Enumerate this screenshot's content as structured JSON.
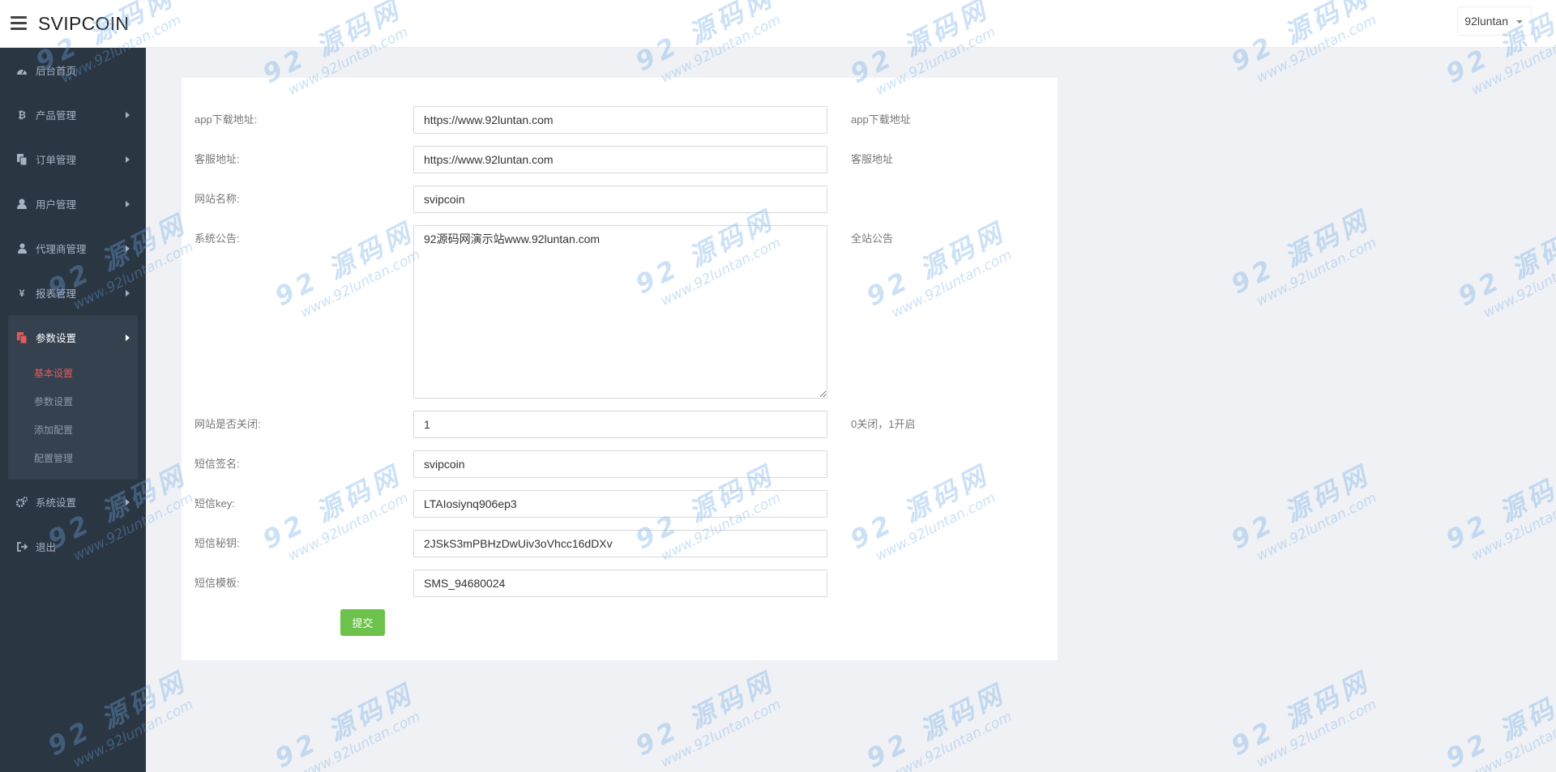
{
  "header": {
    "brand": "SVIPCOIN",
    "user_name": "92luntan"
  },
  "sidebar": {
    "items": [
      {
        "label": "后台首页",
        "icon": "dashboard-icon",
        "has_arrow": false
      },
      {
        "label": "产品管理",
        "icon": "bitcoin-icon",
        "has_arrow": true
      },
      {
        "label": "订单管理",
        "icon": "copy-icon",
        "has_arrow": true
      },
      {
        "label": "用户管理",
        "icon": "user-icon",
        "has_arrow": true
      },
      {
        "label": "代理商管理",
        "icon": "users-icon",
        "has_arrow": true
      },
      {
        "label": "报表管理",
        "icon": "yen-icon",
        "has_arrow": true
      },
      {
        "label": "参数设置",
        "icon": "files-icon",
        "has_arrow": true
      },
      {
        "label": "系统设置",
        "icon": "cogs-icon",
        "has_arrow": true
      },
      {
        "label": "退出",
        "icon": "sign-out-icon",
        "has_arrow": false
      }
    ],
    "sub_items": [
      {
        "label": "基本设置",
        "active": true
      },
      {
        "label": "参数设置",
        "active": false
      },
      {
        "label": "添加配置",
        "active": false
      },
      {
        "label": "配置管理",
        "active": false
      }
    ]
  },
  "form": {
    "fields": [
      {
        "label": "app下载地址:",
        "value": "https://www.92luntan.com",
        "help": "app下载地址"
      },
      {
        "label": "客服地址:",
        "value": "https://www.92luntan.com",
        "help": "客服地址"
      },
      {
        "label": "网站名称:",
        "value": "svipcoin",
        "help": ""
      },
      {
        "label": "系统公告:",
        "value": "92源码网演示站www.92luntan.com",
        "help": "全站公告"
      },
      {
        "label": "网站是否关闭:",
        "value": "1",
        "help": "0关闭，1开启"
      },
      {
        "label": "短信签名:",
        "value": "svipcoin",
        "help": ""
      },
      {
        "label": "短信key:",
        "value": "LTAIosiynq906ep3",
        "help": ""
      },
      {
        "label": "短信秘钥:",
        "value": "2JSkS3mPBHzDwUiv3oVhcc16dDXv",
        "help": ""
      },
      {
        "label": "短信模板:",
        "value": "SMS_94680024",
        "help": ""
      }
    ],
    "submit_label": "提交"
  },
  "watermark": {
    "main": "92 源码网",
    "url": "www.92luntan.com"
  },
  "colors": {
    "sidebar_bg": "#2b3643",
    "accent_red": "#e35b5a",
    "submit_green": "#6cc24a"
  }
}
